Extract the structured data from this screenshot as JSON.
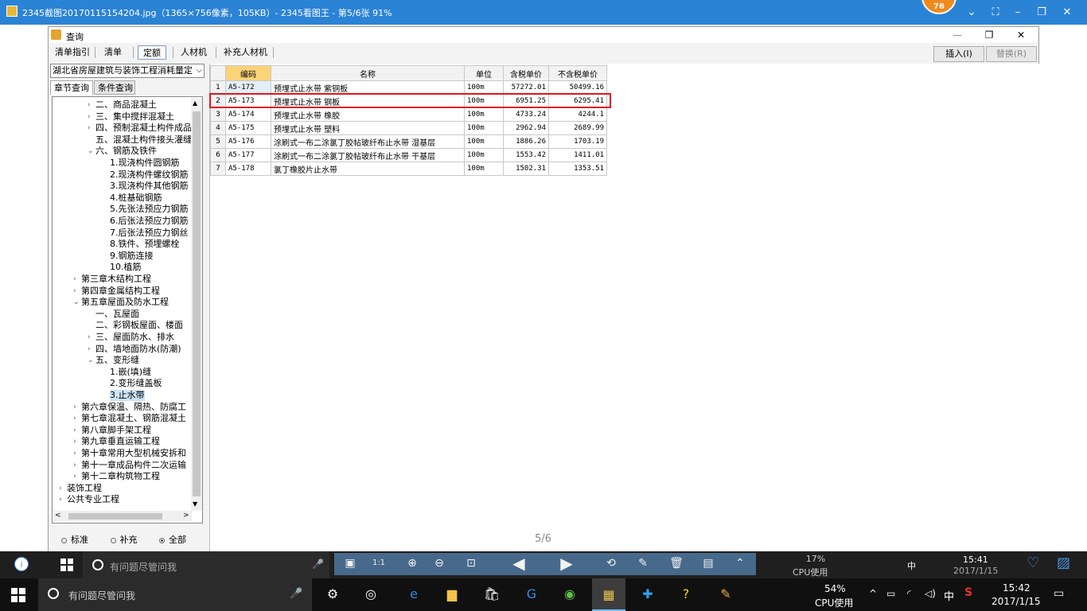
{
  "viewer": {
    "title": "2345截图20170115154204.jpg（1365×756像素，105KB）- 2345看图王 - 第5/6张 91%",
    "badge": "76",
    "page_counter": "5/6"
  },
  "query_window": {
    "title": "查询",
    "top_tabs": [
      "清单指引",
      "清单",
      "定额",
      "人材机",
      "补充人材机"
    ],
    "active_tab": "定额",
    "insert_button": "插入(I)",
    "replace_button": "替换(R)"
  },
  "left_panel": {
    "library_select": "湖北省房屋建筑与装饰工程消耗量定",
    "sub_tabs": [
      "章节查询",
      "条件查询"
    ],
    "tree": [
      {
        "label": "二、商品混凝土",
        "level": 2,
        "arrow": "right"
      },
      {
        "label": "三、集中搅拌混凝土",
        "level": 2,
        "arrow": "right"
      },
      {
        "label": "四、预制混凝土构件成品",
        "level": 2,
        "arrow": "right"
      },
      {
        "label": "五、混凝土构件接头灌缝",
        "level": 2,
        "arrow": "none"
      },
      {
        "label": "六、钢筋及铁件",
        "level": 2,
        "arrow": "down"
      },
      {
        "label": "1.现浇构件圆钢筋",
        "level": 3,
        "arrow": "none"
      },
      {
        "label": "2.现浇构件螺纹钢筋",
        "level": 3,
        "arrow": "none"
      },
      {
        "label": "3.现浇构件其他钢筋",
        "level": 3,
        "arrow": "none"
      },
      {
        "label": "4.桩基础钢筋",
        "level": 3,
        "arrow": "none"
      },
      {
        "label": "5.先张法预应力钢筋",
        "level": 3,
        "arrow": "none"
      },
      {
        "label": "6.后张法预应力钢筋",
        "level": 3,
        "arrow": "none"
      },
      {
        "label": "7.后张法预应力钢丝",
        "level": 3,
        "arrow": "none"
      },
      {
        "label": "8.铁件、预埋螺栓",
        "level": 3,
        "arrow": "none"
      },
      {
        "label": "9.钢筋连接",
        "level": 3,
        "arrow": "none"
      },
      {
        "label": "10.植筋",
        "level": 3,
        "arrow": "none"
      },
      {
        "label": "第三章木结构工程",
        "level": 1,
        "arrow": "right"
      },
      {
        "label": "第四章金属结构工程",
        "level": 1,
        "arrow": "right"
      },
      {
        "label": "第五章屋面及防水工程",
        "level": 1,
        "arrow": "down"
      },
      {
        "label": "一、瓦屋面",
        "level": 2,
        "arrow": "none"
      },
      {
        "label": "二、彩钢板屋面、楼面",
        "level": 2,
        "arrow": "none"
      },
      {
        "label": "三、屋面防水、排水",
        "level": 2,
        "arrow": "right"
      },
      {
        "label": "四、墙地面防水(防潮)",
        "level": 2,
        "arrow": "right"
      },
      {
        "label": "五、变形缝",
        "level": 2,
        "arrow": "down"
      },
      {
        "label": "1.嵌(填)缝",
        "level": 3,
        "arrow": "none"
      },
      {
        "label": "2.变形缝盖板",
        "level": 3,
        "arrow": "none"
      },
      {
        "label": "3.止水带",
        "level": 3,
        "arrow": "none",
        "selected": true
      },
      {
        "label": "第六章保温、隔热、防腐工",
        "level": 1,
        "arrow": "right"
      },
      {
        "label": "第七章混凝土、钢筋混凝土",
        "level": 1,
        "arrow": "right"
      },
      {
        "label": "第八章脚手架工程",
        "level": 1,
        "arrow": "right"
      },
      {
        "label": "第九章垂直运输工程",
        "level": 1,
        "arrow": "right"
      },
      {
        "label": "第十章常用大型机械安拆和",
        "level": 1,
        "arrow": "right"
      },
      {
        "label": "第十一章成品构件二次运输",
        "level": 1,
        "arrow": "right"
      },
      {
        "label": "第十二章构筑物工程",
        "level": 1,
        "arrow": "right"
      },
      {
        "label": "装饰工程",
        "level": 0,
        "arrow": "right"
      },
      {
        "label": "公共专业工程",
        "level": 0,
        "arrow": "right"
      }
    ],
    "radios": [
      {
        "label": "标准",
        "checked": false
      },
      {
        "label": "补充",
        "checked": false
      },
      {
        "label": "全部",
        "checked": true
      }
    ]
  },
  "grid": {
    "headers": [
      "编码",
      "名称",
      "单位",
      "含税单价",
      "不含税单价"
    ],
    "rows": [
      {
        "idx": "1",
        "code": "A5-172",
        "name": "预埋式止水带 紫铜板",
        "unit": "100m",
        "price_tax": "57272.01",
        "price_notax": "50499.16"
      },
      {
        "idx": "2",
        "code": "A5-173",
        "name": "预埋式止水带 钢板",
        "unit": "100m",
        "price_tax": "6951.25",
        "price_notax": "6295.41"
      },
      {
        "idx": "3",
        "code": "A5-174",
        "name": "预埋式止水带 橡胶",
        "unit": "100m",
        "price_tax": "4733.24",
        "price_notax": "4244.1"
      },
      {
        "idx": "4",
        "code": "A5-175",
        "name": "预埋式止水带 塑料",
        "unit": "100m",
        "price_tax": "2962.94",
        "price_notax": "2689.99"
      },
      {
        "idx": "5",
        "code": "A5-176",
        "name": "涂刷式一布二涂氯丁胶帖玻纤布止水带 湿基层",
        "unit": "100m",
        "price_tax": "1886.26",
        "price_notax": "1703.19"
      },
      {
        "idx": "6",
        "code": "A5-177",
        "name": "涂刷式一布二涂氯丁胶帖玻纤布止水带 干基层",
        "unit": "100m",
        "price_tax": "1553.42",
        "price_notax": "1411.01"
      },
      {
        "idx": "7",
        "code": "A5-178",
        "name": "氯丁橡胶片止水带",
        "unit": "100m",
        "price_tax": "1502.31",
        "price_notax": "1353.51"
      }
    ]
  },
  "inner_taskbar": {
    "search_placeholder": "有问题尽管问我",
    "cpu_percent": "17%",
    "cpu_label": "CPU使用",
    "ime": "中",
    "time": "15:41",
    "date": "2017/1/15"
  },
  "taskbar": {
    "search_placeholder": "有问题尽管问我",
    "cpu_percent": "54%",
    "cpu_label": "CPU使用",
    "ime": "中",
    "time": "15:42",
    "date": "2017/1/15"
  },
  "colors": {
    "titlebar": "#2b83d6",
    "header_highlight": "#fbd479",
    "red_box": "#e0161a",
    "taskbar": "#101010"
  }
}
